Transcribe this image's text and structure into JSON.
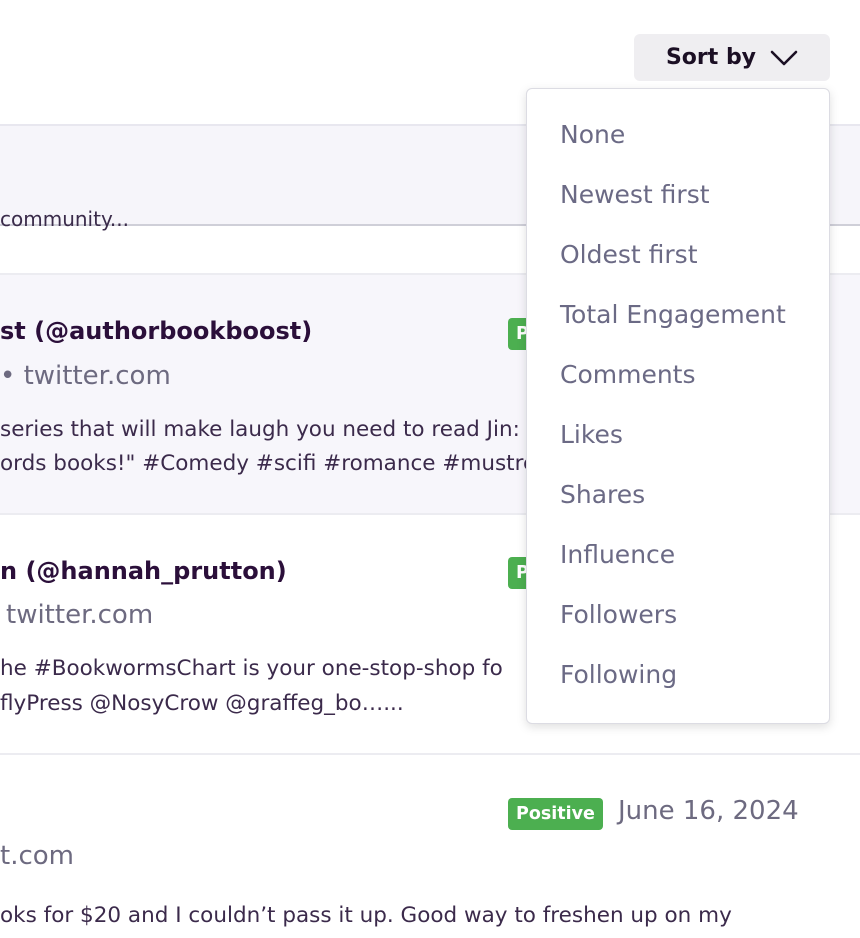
{
  "toolbar": {
    "sort_label": "Sort by"
  },
  "sort_menu": {
    "options": [
      "None",
      "Newest first",
      "Oldest first",
      "Total Engagement",
      "Comments",
      "Likes",
      "Shares",
      "Influence",
      "Followers",
      "Following"
    ]
  },
  "posts": [
    {
      "content_lines": [
        "community..."
      ]
    },
    {
      "author": "st (@authorbookboost)",
      "source": "• twitter.com",
      "badge": "P",
      "content_lines": [
        "series that will make laugh you need to read Jin:",
        "ords books!\" #Comedy #scifi #romance #mustre"
      ]
    },
    {
      "author": "n (@hannah_prutton)",
      "source": "twitter.com",
      "badge": "P",
      "content_lines": [
        "he #BookwormsChart is your one-stop-shop fo",
        "flyPress @NosyCrow @graffeg_bo…..."
      ]
    },
    {
      "source": "t.com",
      "badge": "Positive",
      "date": "June 16, 2024",
      "content_lines": [
        "oks for $20 and I couldn’t pass it up. Good way to freshen up on my"
      ]
    }
  ],
  "colors": {
    "positive_badge": "#4caf50",
    "menu_text": "#6b6a85",
    "author_text": "#2b0f3a"
  }
}
